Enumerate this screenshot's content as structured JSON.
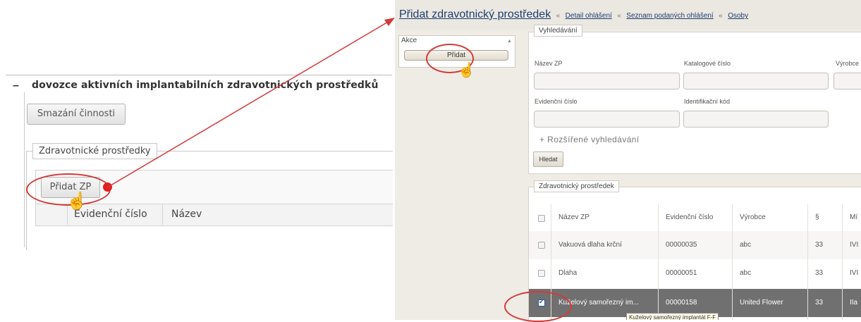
{
  "left": {
    "minus_glyph": "–",
    "section_title": "dovozce aktivních implantabilních zdravotnických prostředků",
    "delete_button": "Smazání činnosti",
    "fieldset_legend": "Zdravotnické prostředky",
    "add_button": "Přidat ZP",
    "columns": [
      "Evidenční číslo",
      "Název"
    ]
  },
  "right": {
    "breadcrumb": {
      "title": "Přidat zdravotnický prostředek",
      "separator": "«",
      "links": [
        "Detail ohlášení",
        "Seznam podaných ohlášení",
        "Osoby"
      ]
    },
    "actions_panel": {
      "label": "Akce",
      "collapse_arrow": "▲",
      "add_button": "Přidat"
    },
    "search": {
      "legend": "Vyhledávání",
      "fields": {
        "nazev_zp": "Název ZP",
        "katalogove_cislo": "Katalogové číslo",
        "vyrobce": "Výrobce",
        "evidencni_cislo": "Evidenční číslo",
        "identifikacni_kod": "Identifikační kód"
      },
      "advanced": "+ Rozšířené vyhledávání",
      "search_button": "Hledat"
    },
    "results": {
      "legend": "Zdravotnický prostředek",
      "columns": [
        "Název ZP",
        "Evidenční číslo",
        "Výrobce",
        "§",
        "Mí"
      ],
      "rows": [
        {
          "name": "Vakuová dlaha krční",
          "evid": "00000035",
          "vyrobce": "abc",
          "par": "33",
          "extra": "IVI",
          "checked": false
        },
        {
          "name": "Dlaha",
          "evid": "00000051",
          "vyrobce": "abc",
          "par": "33",
          "extra": "IVI",
          "checked": false
        },
        {
          "name": "Kuželový samořezný im...",
          "evid": "00000158",
          "vyrobce": "United Flower",
          "par": "33",
          "extra": "IIa",
          "checked": true
        }
      ],
      "tooltip": "Kuželový samořezný implantát F-F"
    }
  },
  "annotation": {
    "color": "#d43a3a",
    "selected_row_color": "#707070"
  }
}
